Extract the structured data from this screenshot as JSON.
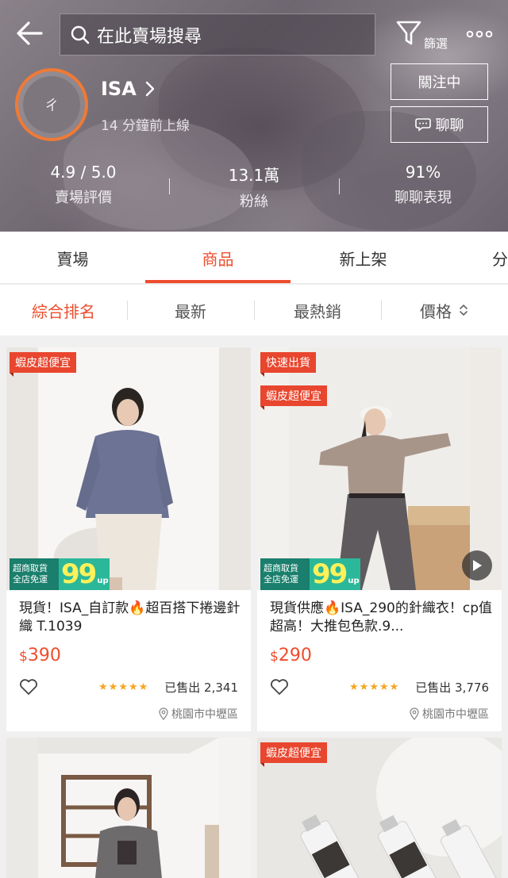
{
  "header": {
    "search_placeholder": "在此賣場搜尋",
    "filter_label": "篩選",
    "shop_name": "ISA",
    "avatar_text": "ㄔ",
    "online_status": "14 分鐘前上線",
    "follow_label": "關注中",
    "chat_label": "聊聊",
    "stats": [
      {
        "value": "4.9 / 5.0",
        "label": "賣場評價"
      },
      {
        "value": "13.1萬",
        "label": "粉絲"
      },
      {
        "value": "91%",
        "label": "聊聊表現"
      }
    ]
  },
  "tabs": [
    "賣場",
    "商品",
    "新上架",
    "分"
  ],
  "active_tab": "商品",
  "sort": [
    "綜合排名",
    "最新",
    "最熱銷",
    "價格"
  ],
  "active_sort": "綜合排名",
  "promo": {
    "line1": "超商取貨",
    "line2": "全店免運",
    "currency": "$",
    "amount": "99",
    "suffix": "up"
  },
  "products": [
    {
      "tags": [
        "蝦皮超便宜"
      ],
      "title": "現貨！ISA_自訂款🔥超百搭下捲邊針織 T.1039",
      "currency": "$",
      "price": "390",
      "rating": 5,
      "sold": "已售出 2,341",
      "location": "桃園市中壢區",
      "has_video": false
    },
    {
      "tags": [
        "快速出貨",
        "蝦皮超便宜"
      ],
      "title": "現貨供應🔥ISA_290的針織衣！cp值超高！大推包色款.9...",
      "currency": "$",
      "price": "290",
      "rating": 5,
      "sold": "已售出 3,776",
      "location": "桃園市中壢區",
      "has_video": true
    },
    {
      "tags": []
    },
    {
      "tags": [
        "蝦皮超便宜"
      ]
    }
  ],
  "colors": {
    "accent": "#ee4d2d",
    "follow_ring": "#ef7a36",
    "promo_dark": "#1a7f6c",
    "promo_light": "#2bb89a"
  }
}
